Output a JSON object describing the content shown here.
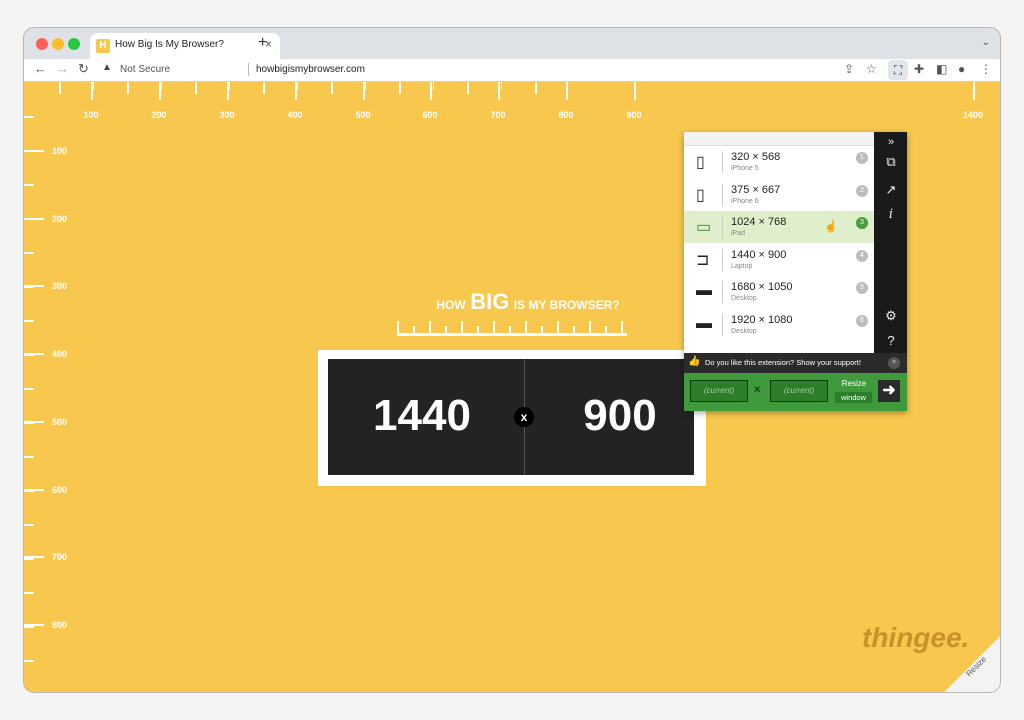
{
  "browser": {
    "tab_title": "How Big Is My Browser?",
    "tab_favicon": "H",
    "tab_close": "×",
    "new_tab": "+",
    "tab_menu": "⌄",
    "security_label": "Not Secure",
    "url": "howbigismybrowser.com",
    "icons": [
      "back-arrow-icon",
      "forward-arrow-icon",
      "reload-icon",
      "warning-icon",
      "share-icon",
      "star-icon",
      "extension-resize-icon",
      "puzzle-icon",
      "sidebar-icon",
      "profile-icon",
      "menu-dots-icon"
    ],
    "colors": {
      "traffic_red": "#ff5f57",
      "traffic_yellow": "#febc2e",
      "traffic_green": "#28c840"
    }
  },
  "page": {
    "background_color": "#f7c84d",
    "ruler_top_labels": [
      "100",
      "200",
      "300",
      "400",
      "500",
      "600",
      "700",
      "800",
      "900",
      "1400"
    ],
    "ruler_left_labels": [
      "100",
      "200",
      "300",
      "400",
      "500",
      "600",
      "700",
      "800"
    ],
    "logo": {
      "how": "HOW",
      "big": "BIG",
      "rest": "IS MY BROWSER?"
    },
    "width_value": "1440",
    "times_symbol": "x",
    "height_value": "900",
    "brand": "thingee.",
    "resize_corner_label": "Resize"
  },
  "extension": {
    "presets": [
      {
        "resolution": "320 × 568",
        "device": "iPhone 5",
        "number": "1",
        "icon": "phone-icon",
        "glyph": "▯"
      },
      {
        "resolution": "375 × 667",
        "device": "iPhone 6",
        "number": "2",
        "icon": "phone-icon",
        "glyph": "▯"
      },
      {
        "resolution": "1024 × 768",
        "device": "iPad",
        "number": "3",
        "icon": "tablet-icon",
        "glyph": "▭"
      },
      {
        "resolution": "1440 × 900",
        "device": "Laptop",
        "number": "4",
        "icon": "laptop-icon",
        "glyph": "⊐"
      },
      {
        "resolution": "1680 × 1050",
        "device": "Desktop",
        "number": "5",
        "icon": "desktop-icon",
        "glyph": "▬"
      },
      {
        "resolution": "1920 × 1080",
        "device": "Desktop",
        "number": "6",
        "icon": "desktop-icon",
        "glyph": "▬"
      }
    ],
    "active_preset": "1024 × 768",
    "side_icons": [
      "collapse-icon",
      "rotate-device-icon",
      "ruler-icon",
      "info-icon",
      "settings-icon",
      "help-icon"
    ],
    "support_text": "Do you like this extension? Show your support!",
    "support_close": "×",
    "width_placeholder": "(current)",
    "height_placeholder": "(current)",
    "times_symbol": "×",
    "resize_label": "Resize",
    "resize_window_label": "window",
    "go_symbol": "➜",
    "colors": {
      "green": "#3f9a3b",
      "dark": "#1a1a1a",
      "active_row": "#dfeecb"
    }
  }
}
